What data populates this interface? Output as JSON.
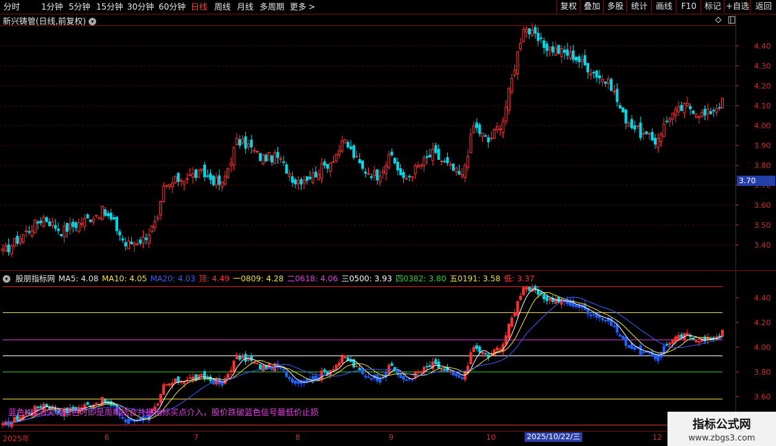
{
  "toolbar": {
    "periods": [
      "分时",
      "1分钟",
      "5分钟",
      "15分钟",
      "30分钟",
      "60分钟",
      "日线",
      "周线",
      "月线",
      "多周期",
      "更多"
    ],
    "active_period": "日线",
    "more_arrow": ">",
    "right_buttons": [
      "复权",
      "叠加",
      "多股",
      "统计",
      "画线",
      "F10",
      "标记",
      "+自选",
      "返回"
    ]
  },
  "upper_panel": {
    "title": "新兴铸管(日线,前复权)",
    "price_ticks": [
      "4.40",
      "4.30",
      "4.20",
      "4.10",
      "4.00",
      "3.90",
      "3.80",
      "3.70",
      "3.60",
      "3.50",
      "3.40"
    ],
    "current_price": "3.70",
    "icons": [
      "diamond-icon",
      "window-icon"
    ]
  },
  "lower_panel": {
    "legend": [
      {
        "text": "股朋指标网",
        "color": "#e6e6e6"
      },
      {
        "text": "MA5: 4.08",
        "color": "#e6e6e6"
      },
      {
        "text": "MA10: 4.05",
        "color": "#f0e040"
      },
      {
        "text": "MA20: 4.03",
        "color": "#3a5cff"
      },
      {
        "text": "顶: 4.49",
        "color": "#ff3030"
      },
      {
        "text": "一0809: 4.28",
        "color": "#f0e040"
      },
      {
        "text": "二0618: 4.06",
        "color": "#e040e0"
      },
      {
        "text": "三0500: 3.93",
        "color": "#ffffff"
      },
      {
        "text": "四0382: 3.80",
        "color": "#30d030"
      },
      {
        "text": "五0191: 3.58",
        "color": "#f0e040"
      },
      {
        "text": "低: 3.37",
        "color": "#ff3030"
      }
    ],
    "price_ticks": [
      "4.40",
      "4.20",
      "4.00",
      "3.80",
      "3.60"
    ],
    "levels": [
      {
        "value": 4.49,
        "color": "#e03030"
      },
      {
        "value": 4.28,
        "color": "#f0e060"
      },
      {
        "value": 4.06,
        "color": "#e040e0"
      },
      {
        "value": 3.93,
        "color": "#ffffff"
      },
      {
        "value": 3.8,
        "color": "#30d030"
      },
      {
        "value": 3.58,
        "color": "#f0e040"
      },
      {
        "value": 3.37,
        "color": "#e03030"
      }
    ],
    "signal_text": "蓝色K线消失转红色时即是周期结合共振指标买点介入，股价跌破蓝色信号最低价止损"
  },
  "x_axis": {
    "labels": [
      "2025年",
      "6",
      "7",
      "8",
      "9",
      "10",
      "12"
    ],
    "highlight": "2025/10/22/三"
  },
  "watermark": {
    "title": "指标公式网",
    "url": "www.zbgs3.com"
  },
  "colors": {
    "up": "#ff3030",
    "down": "#00d8e8",
    "signal": "#2060ff",
    "background": "#000000",
    "grid": "#7a1010"
  },
  "candle_data": {
    "anchors": [
      [
        0,
        3.36
      ],
      [
        6,
        3.44
      ],
      [
        14,
        3.54
      ],
      [
        20,
        3.47
      ],
      [
        29,
        3.53
      ],
      [
        34,
        3.57
      ],
      [
        38,
        3.51
      ],
      [
        42,
        3.4
      ],
      [
        48,
        3.43
      ],
      [
        53,
        3.52
      ],
      [
        55,
        3.68
      ],
      [
        60,
        3.73
      ],
      [
        68,
        3.76
      ],
      [
        75,
        3.7
      ],
      [
        80,
        3.92
      ],
      [
        84,
        3.9
      ],
      [
        88,
        3.84
      ],
      [
        94,
        3.84
      ],
      [
        100,
        3.72
      ],
      [
        106,
        3.75
      ],
      [
        112,
        3.82
      ],
      [
        117,
        3.92
      ],
      [
        123,
        3.78
      ],
      [
        128,
        3.75
      ],
      [
        133,
        3.85
      ],
      [
        137,
        3.72
      ],
      [
        141,
        3.78
      ],
      [
        147,
        3.86
      ],
      [
        152,
        3.8
      ],
      [
        157,
        3.74
      ],
      [
        161,
        4.0
      ],
      [
        166,
        3.92
      ],
      [
        171,
        4.03
      ],
      [
        178,
        4.5
      ],
      [
        185,
        4.4
      ],
      [
        195,
        4.35
      ],
      [
        208,
        4.2
      ],
      [
        212,
        4.05
      ],
      [
        218,
        3.96
      ],
      [
        223,
        3.92
      ],
      [
        228,
        4.05
      ],
      [
        234,
        4.1
      ],
      [
        240,
        4.05
      ],
      [
        246,
        4.12
      ]
    ]
  }
}
